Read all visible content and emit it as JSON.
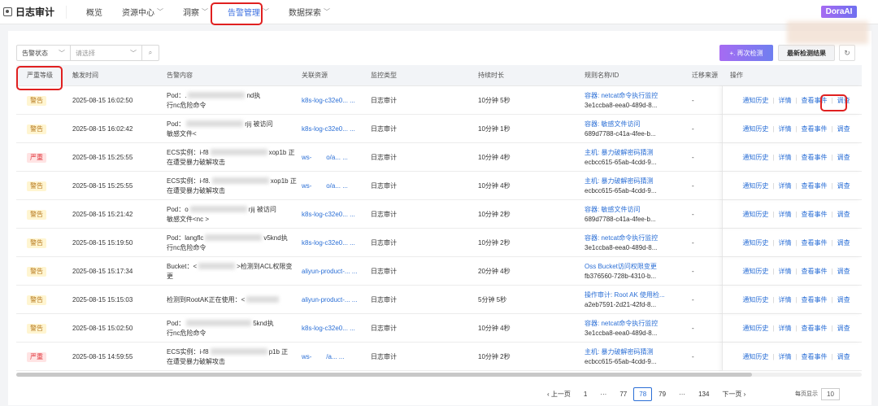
{
  "app": {
    "title": "日志审计",
    "ai_label": "DoraAI"
  },
  "nav": [
    {
      "label": "概览",
      "dropdown": false
    },
    {
      "label": "资源中心",
      "dropdown": true
    },
    {
      "label": "洞察",
      "dropdown": true
    },
    {
      "label": "告警管理",
      "dropdown": true,
      "active": true
    },
    {
      "label": "数据探索",
      "dropdown": true
    }
  ],
  "filter": {
    "status_label": "告警状态",
    "placeholder": "请选择"
  },
  "toolbar": {
    "recheck": "+. 再次检测",
    "latest": "最新检测结果",
    "refresh_icon": "refresh-icon"
  },
  "columns": [
    "严重等级",
    "触发时间",
    "告警内容",
    "关联资源",
    "监控类型",
    "持续时长",
    "规则名称/ID",
    "迁移来源",
    "操作"
  ],
  "ops": [
    "通知历史",
    "详情",
    "查看事件",
    "调查"
  ],
  "rows": [
    {
      "level": "警告",
      "sev": "warn",
      "time": "2025-08-15 16:02:50",
      "c1a": "Pod：.",
      "c1b": "nd执",
      "c2": "行nc危险命令",
      "res": "k8s-log-c32e0... ...",
      "type": "日志审计",
      "dur": "10分钟 5秒",
      "rule": "容器: netcat命令执行监控",
      "rid": "3e1ccba8-eea0-489d-8...",
      "src": "-"
    },
    {
      "level": "警告",
      "sev": "warn",
      "time": "2025-08-15 16:02:42",
      "c1a": "Pod：",
      "c1b": "rjij 被访问",
      "c2": "敏感文件<",
      "res": "k8s-log-c32e0... ...",
      "type": "日志审计",
      "dur": "10分钟 1秒",
      "rule": "容器: 敏感文件访问",
      "rid": "689d7788-c41a-4fee-b...",
      "src": "-"
    },
    {
      "level": "严重",
      "sev": "crit",
      "time": "2025-08-15 15:25:55",
      "c1a": "ECS实例：i-f8",
      "c1b": "xop1b 正",
      "c2": "在遭受暴力破解攻击",
      "res": "ws-        o/a... ...",
      "type": "日志审计",
      "dur": "10分钟 4秒",
      "rule": "主机: 暴力破解密码猜测",
      "rid": "ecbcc615-65ab-4cdd-9...",
      "src": "-"
    },
    {
      "level": "警告",
      "sev": "warn",
      "time": "2025-08-15 15:25:55",
      "c1a": "ECS实例：i-f8.",
      "c1b": "xop1b 正",
      "c2": "在遭受暴力破解攻击",
      "res": "ws-        o/a... ...",
      "type": "日志审计",
      "dur": "10分钟 4秒",
      "rule": "主机: 暴力破解密码猜测",
      "rid": "ecbcc615-65ab-4cdd-9...",
      "src": "-"
    },
    {
      "level": "警告",
      "sev": "warn",
      "time": "2025-08-15 15:21:42",
      "c1a": "Pod：o",
      "c1b": "rjij 被访问",
      "c2": "敏感文件<nc    >",
      "res": "k8s-log-c32e0... ...",
      "type": "日志审计",
      "dur": "10分钟 2秒",
      "rule": "容器: 敏感文件访问",
      "rid": "689d7788-c41a-4fee-b...",
      "src": "-"
    },
    {
      "level": "警告",
      "sev": "warn",
      "time": "2025-08-15 15:19:50",
      "c1a": "Pod：langflc",
      "c1b": "v5knd执",
      "c2": "行nc危险命令",
      "res": "k8s-log-c32e0... ...",
      "type": "日志审计",
      "dur": "10分钟 2秒",
      "rule": "容器: netcat命令执行监控",
      "rid": "3e1ccba8-eea0-489d-8...",
      "src": "-"
    },
    {
      "level": "警告",
      "sev": "warn",
      "time": "2025-08-15 15:17:34",
      "c1a": "Bucket：<",
      "c1b": ">检测到ACL权限变",
      "c2": "更",
      "res": "aliyun-product-... ...",
      "type": "日志审计",
      "dur": "20分钟 4秒",
      "rule": "Oss Bucket访问权限变更",
      "rid": "fb376560-728b-4310-b...",
      "src": "-"
    },
    {
      "level": "警告",
      "sev": "warn",
      "time": "2025-08-15 15:15:03",
      "c1a": "检测到RootAK正在使用：<",
      "c1b": "",
      "c2": "",
      "res": "aliyun-product-... ...",
      "type": "日志审计",
      "dur": "5分钟 5秒",
      "rule": "操作审计: Root AK 使用检...",
      "rid": "a2eb7591-2d21-42fd-8...",
      "src": "-"
    },
    {
      "level": "警告",
      "sev": "warn",
      "time": "2025-08-15 15:02:50",
      "c1a": "Pod：",
      "c1b": "5knd执",
      "c2": "行nc危险命令",
      "res": "k8s-log-c32e0... ...",
      "type": "日志审计",
      "dur": "10分钟 4秒",
      "rule": "容器: netcat命令执行监控",
      "rid": "3e1ccba8-eea0-489d-8...",
      "src": "-"
    },
    {
      "level": "严重",
      "sev": "crit",
      "time": "2025-08-15 14:59:55",
      "c1a": "ECS实例：i-f8",
      "c1b": "p1b 正",
      "c2": "在遭受暴力破解攻击",
      "res": "ws-        /a... ...",
      "type": "日志审计",
      "dur": "10分钟 2秒",
      "rule": "主机: 暴力破解密码猜测",
      "rid": "ecbcc615-65ab-4cdd-9...",
      "src": "-"
    }
  ],
  "pagination": {
    "prev": "上一页",
    "next": "下一页",
    "pages": [
      "1",
      "···",
      "77",
      "78",
      "79",
      "···",
      "134"
    ],
    "current": "78",
    "per_page_label": "每页显示",
    "per_page": "10"
  },
  "colors": {
    "accent": "#2b6fd6",
    "warn_bg": "#fff5d1",
    "crit_bg": "#ffe4e4",
    "highlight": "#e02020"
  }
}
